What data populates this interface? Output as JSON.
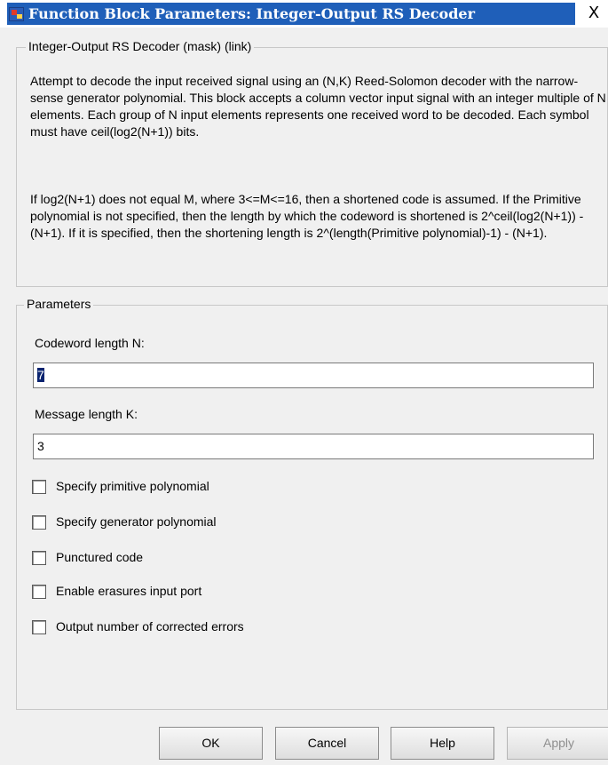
{
  "window": {
    "title": "Function Block Parameters: Integer-Output RS Decoder",
    "close_label": "X"
  },
  "description_group": {
    "legend": "Integer-Output RS Decoder (mask) (link)",
    "paragraph1": "Attempt to decode the input received signal using an (N,K) Reed-Solomon decoder with the narrow-sense generator polynomial.  This block accepts a column vector input signal with an integer multiple of N elements.  Each group of N input elements represents one received word to be decoded.  Each symbol must have ceil(log2(N+1)) bits.",
    "paragraph2": "If log2(N+1) does not equal M, where 3<=M<=16, then a shortened code is assumed.  If the Primitive polynomial is not specified, then the length by which the codeword is shortened is 2^ceil(log2(N+1)) - (N+1).  If it is specified, then the shortening length is 2^(length(Primitive polynomial)-1) - (N+1)."
  },
  "parameters": {
    "legend": "Parameters",
    "codeword_length": {
      "label": "Codeword length N:",
      "value": "7"
    },
    "message_length": {
      "label": "Message length K:",
      "value": "3"
    },
    "checkboxes": [
      {
        "label": "Specify primitive polynomial",
        "checked": false
      },
      {
        "label": "Specify generator polynomial",
        "checked": false
      },
      {
        "label": "Punctured code",
        "checked": false
      },
      {
        "label": "Enable erasures input port",
        "checked": false
      },
      {
        "label": "Output number of corrected errors",
        "checked": false
      }
    ]
  },
  "buttons": {
    "ok": "OK",
    "cancel": "Cancel",
    "help": "Help",
    "apply": "Apply"
  }
}
